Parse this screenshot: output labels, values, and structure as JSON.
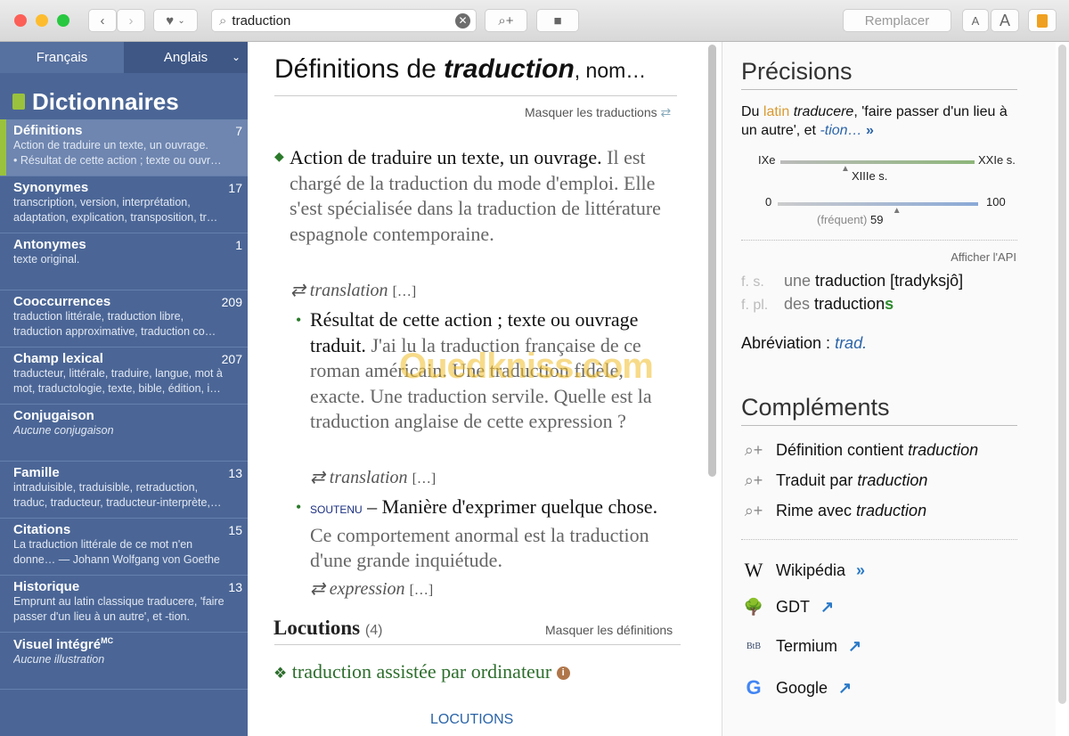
{
  "toolbar": {
    "search_value": "traduction",
    "replace_label": "Remplacer",
    "font_small": "A",
    "font_large": "A"
  },
  "sidebar": {
    "tabs": [
      "Français",
      "Anglais"
    ],
    "title": "Dictionnaires",
    "items": [
      {
        "title": "Définitions",
        "count": "7",
        "lines": [
          "Action de traduire un texte, un ouvrage.",
          "• Résultat de cette action ; texte ou ouvr…"
        ]
      },
      {
        "title": "Synonymes",
        "count": "17",
        "lines": [
          "transcription, version, interprétation,",
          "adaptation, explication, transposition, tr…"
        ]
      },
      {
        "title": "Antonymes",
        "count": "1",
        "lines": [
          "texte original.",
          ""
        ]
      },
      {
        "title": "Cooccurrences",
        "count": "209",
        "lines": [
          "traduction littérale, traduction libre,",
          "traduction approximative, traduction co…"
        ]
      },
      {
        "title": "Champ lexical",
        "count": "207",
        "lines": [
          "traducteur, littérale, traduire, langue, mot à",
          "mot, traductologie, texte, bible, édition, i…"
        ]
      },
      {
        "title": "Conjugaison",
        "count": "",
        "lines": [
          "Aucune conjugaison",
          ""
        ]
      },
      {
        "title": "Famille",
        "count": "13",
        "lines": [
          "intraduisible, traduisible, retraduction,",
          "traduc, traducteur, traducteur-interprète,…"
        ]
      },
      {
        "title": "Citations",
        "count": "15",
        "lines": [
          "La traduction littérale de ce mot n'en",
          "donne…  — Johann Wolfgang von Goethe"
        ]
      },
      {
        "title": "Historique",
        "count": "13",
        "lines": [
          "Emprunt au latin classique traducere, 'faire",
          "passer d'un lieu à un autre', et -tion."
        ]
      },
      {
        "title": "Visuel intégré",
        "sup": "MC",
        "count": "",
        "lines": [
          "Aucune illustration",
          ""
        ]
      }
    ]
  },
  "center": {
    "title_prefix": "Définitions de ",
    "word": "traduction",
    "pos": ", nom…",
    "hide_translations": "Masquer les traductions",
    "defs": [
      {
        "text": "Action de traduire un texte, un ouvrage.",
        "example": " Il est chargé de la traduction du mode d'emploi. Elle s'est spécialisée dans la traduction de littérature espagnole contemporaine.",
        "translation": "translation",
        "more": "[…]"
      },
      {
        "text": "Résultat de cette action ; texte ou ouvrage traduit.",
        "example": " J'ai lu la traduction française de ce roman américain. Une traduction fidèle, exacte. Une traduction servile. Quelle est la traduction anglaise de cette expression ?",
        "translation": "translation",
        "more": "[…]"
      },
      {
        "register": "SOUTENU",
        "text": " – Manière d'exprimer quelque chose.",
        "example": " Ce comportement anormal est la traduction d'une grande inquiétude.",
        "translation": "expression",
        "more": "[…]"
      }
    ],
    "locutions_title": "Locutions",
    "locutions_count": "(4)",
    "hide_definitions": "Masquer les définitions",
    "locution_1": "traduction assistée par ordinateur",
    "footer_link": "LOCUTIONS",
    "watermark": "Ouedkniss.com"
  },
  "right": {
    "precisions_title": "Précisions",
    "etym": {
      "a": "Du ",
      "latin": "latin",
      "b": " ",
      "word": "traducere",
      "c": ", 'faire passer d'un lieu à un autre', et ",
      "suffix": "-tion…",
      "more": "»"
    },
    "century": {
      "start": "IXe",
      "end": "XXIe s.",
      "marker": "XIIIe s.",
      "value_fraction": 0.33
    },
    "frequency": {
      "min": "0",
      "max": "100",
      "label": "(fréquent)",
      "value": 59
    },
    "api_link": "Afficher l'API",
    "forms": [
      {
        "tag": "f. s.",
        "art": "une ",
        "word": "traduction [tradyksjô]",
        "suffix": ""
      },
      {
        "tag": "f. pl.",
        "art": "des ",
        "word": "traduction",
        "suffix": "s"
      }
    ],
    "abbr_label": "Abréviation : ",
    "abbr": "trad.",
    "complements_title": "Compléments",
    "complements": [
      {
        "label": "Définition contient ",
        "word": "traduction"
      },
      {
        "label": "Traduit par ",
        "word": "traduction"
      },
      {
        "label": "Rime avec ",
        "word": "traduction"
      }
    ],
    "links": [
      "Wikipédia",
      "GDT",
      "Termium",
      "Google"
    ],
    "colors": {
      "sidebar": "#4b6696",
      "accent_green": "#9ac23c",
      "link_blue": "#2a64a8"
    }
  }
}
